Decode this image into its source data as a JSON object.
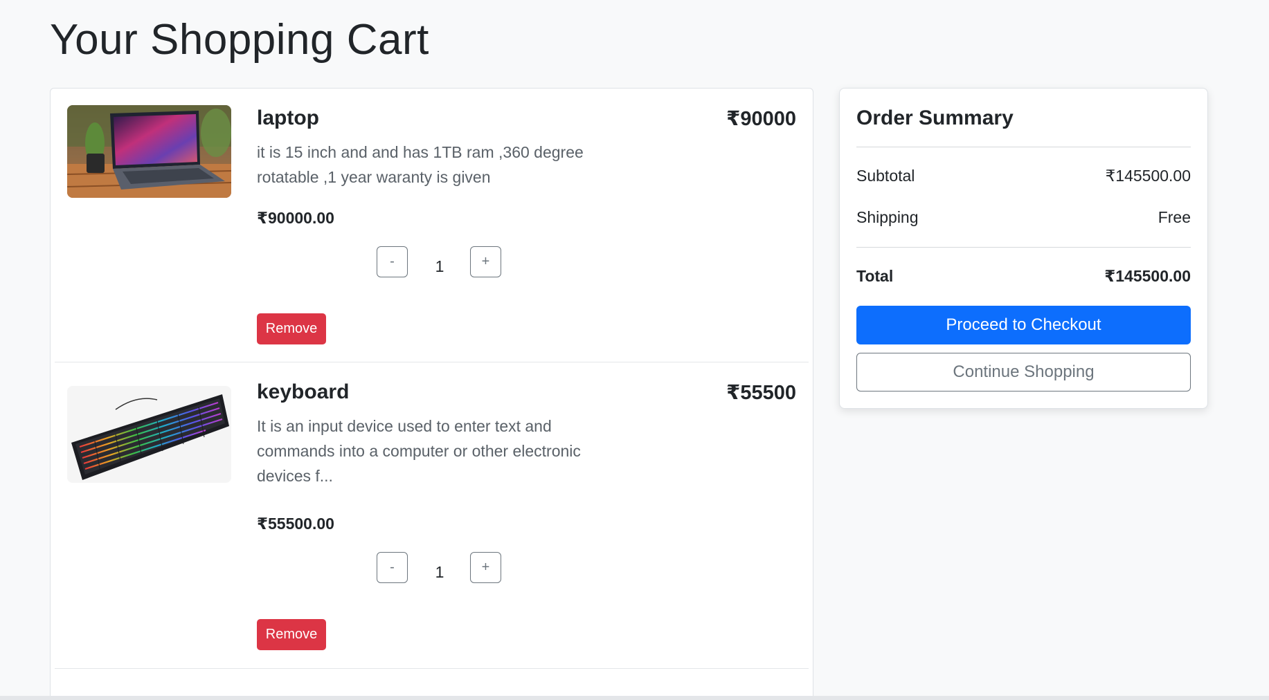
{
  "page": {
    "title": "Your Shopping Cart"
  },
  "cart": {
    "items": [
      {
        "name": "laptop",
        "price_top": "₹90000",
        "description": "it is 15 inch and and has 1TB ram ,360 degree rotatable ,1 year waranty is given",
        "price": "₹90000.00",
        "quantity": "1",
        "minus_label": "-",
        "plus_label": "+",
        "remove_label": "Remove",
        "image_icon": "laptop-photo"
      },
      {
        "name": "keyboard",
        "price_top": "₹55500",
        "description": "It is an input device used to enter text and commands into a computer or other electronic devices f...",
        "price": "₹55500.00",
        "quantity": "1",
        "minus_label": "-",
        "plus_label": "+",
        "remove_label": "Remove",
        "image_icon": "keyboard-photo"
      }
    ]
  },
  "summary": {
    "title": "Order Summary",
    "subtotal_label": "Subtotal",
    "subtotal_value": "₹145500.00",
    "shipping_label": "Shipping",
    "shipping_value": "Free",
    "total_label": "Total",
    "total_value": "₹145500.00",
    "checkout_label": "Proceed to Checkout",
    "continue_label": "Continue Shopping"
  },
  "colors": {
    "primary": "#0d6efd",
    "danger": "#dc3545",
    "secondary": "#6c757d",
    "background": "#f8f9fa"
  }
}
